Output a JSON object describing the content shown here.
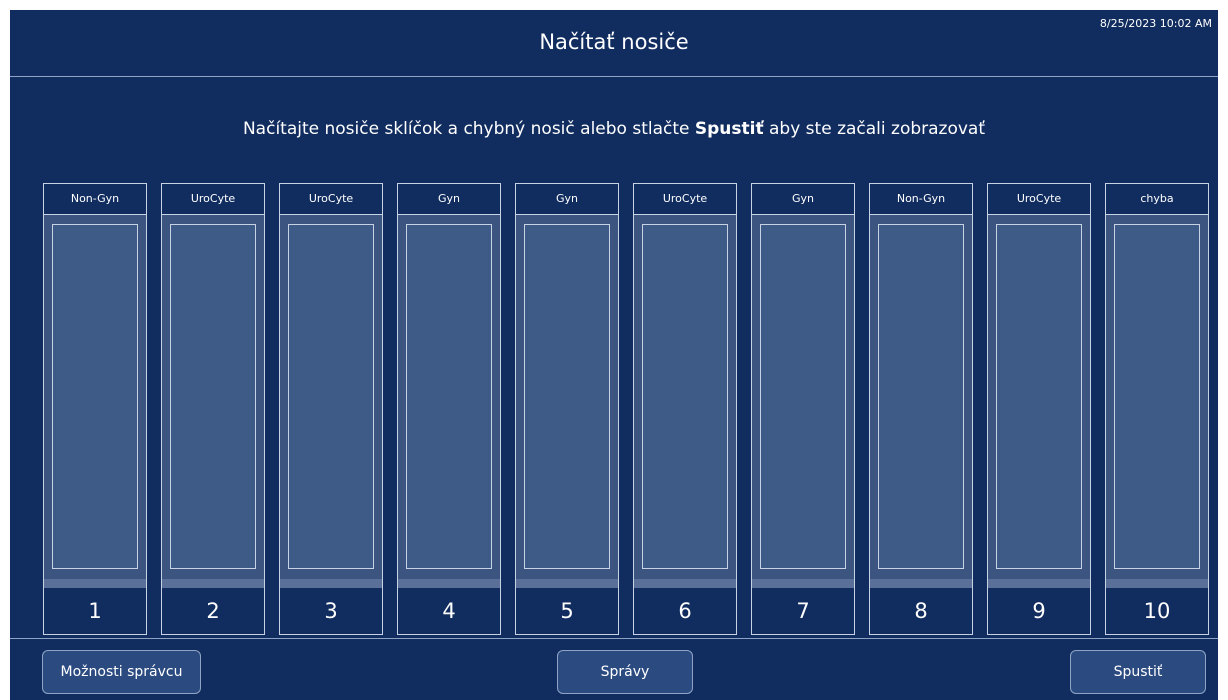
{
  "header": {
    "title": "Načítať nosiče",
    "datetime": "8/25/2023 10:02 AM"
  },
  "instruction": {
    "before": "Načítajte nosiče sklíčok a chybný nosič alebo stlačte ",
    "bold": "Spustiť",
    "after": " aby ste začali zobrazovať"
  },
  "racks": [
    {
      "label": "Non-Gyn",
      "number": "1"
    },
    {
      "label": "UroCyte",
      "number": "2"
    },
    {
      "label": "UroCyte",
      "number": "3"
    },
    {
      "label": "Gyn",
      "number": "4"
    },
    {
      "label": "Gyn",
      "number": "5"
    },
    {
      "label": "UroCyte",
      "number": "6"
    },
    {
      "label": "Gyn",
      "number": "7"
    },
    {
      "label": "Non-Gyn",
      "number": "8"
    },
    {
      "label": "UroCyte",
      "number": "9"
    },
    {
      "label": "chyba",
      "number": "10"
    }
  ],
  "buttons": {
    "admin": "Možnosti správcu",
    "messages": "Správy",
    "start": "Spustiť"
  },
  "colors": {
    "background": "#112d5f",
    "rack_fill": "#3b5580",
    "button": "#2a4a80"
  }
}
